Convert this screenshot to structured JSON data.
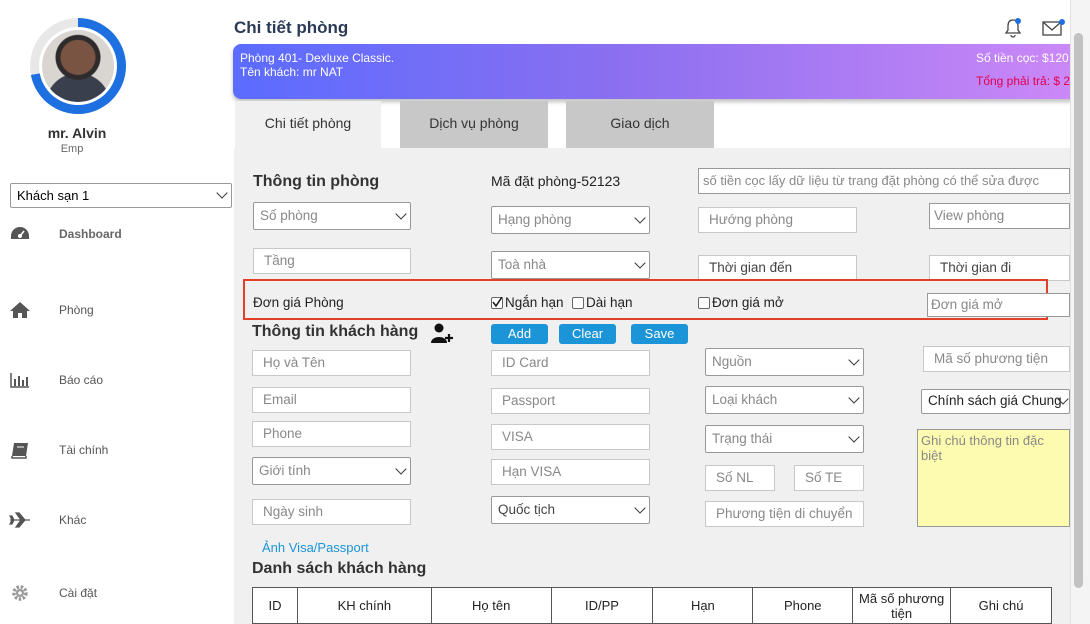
{
  "user": {
    "name": "mr. Alvin",
    "role": "Emp"
  },
  "hotel_select": "Khách sạn 1",
  "nav": [
    {
      "label": "Dashboard",
      "icon": "dashboard-icon"
    },
    {
      "label": "Phòng",
      "icon": "home-icon"
    },
    {
      "label": "Báo cáo",
      "icon": "bar-chart-icon"
    },
    {
      "label": "Tài chính",
      "icon": "book-icon"
    },
    {
      "label": "Khác",
      "icon": "plane-icon"
    },
    {
      "label": "Cài đặt",
      "icon": "gear-icon"
    }
  ],
  "header": {
    "title": "Chi tiết phòng"
  },
  "banner": {
    "room": "Phòng 401- Dexluxe Classic.",
    "guest": "Tên khách: mr NAT",
    "deposit": "Số tiền cọc: $120",
    "total": "Tổng phải trả: $ 2"
  },
  "tabs": [
    "Chi tiết phòng",
    "Dịch vụ phòng",
    "Giao dịch"
  ],
  "room_info": {
    "title": "Thông tin phòng",
    "booking_code": "Mã đặt phòng-52123",
    "deposit_placeholder": "số tiền cọc lấy dữ liệu từ trang đặt phòng có thể sửa được",
    "room_no": "Số phòng",
    "room_class": "Hạng phòng",
    "direction": "Hướng phòng",
    "view": "View phòng",
    "floor": "Tầng",
    "building": "Toà nhà",
    "arrival": "Thời gian đến",
    "departure": "Thời gian đi"
  },
  "price_row": {
    "label": "Đơn giá Phòng",
    "short_term": "Ngắn hạn",
    "short_term_checked": true,
    "long_term": "Dài hạn",
    "open_price": "Đơn giá mở",
    "open_price_placeholder": "Đơn giá mở"
  },
  "guest_info": {
    "title": "Thông tin khách hàng",
    "add": "Add",
    "clear": "Clear",
    "save": "Save",
    "full_name": "Họ và Tên",
    "id_card": "ID Card",
    "source": "Nguồn",
    "commute_code": "Mã số phương tiện",
    "email": "Email",
    "passport": "Passport",
    "guest_type": "Loại khách",
    "price_policy": "Chính sách giá Chung",
    "phone": "Phone",
    "visa": "VISA",
    "status": "Trạng thái",
    "note_placeholder": "Ghi chú thông tin đặc biệt",
    "gender": "Giới tính",
    "visa_expiry": "Hạn VISA",
    "adults": "Số NL",
    "children": "Số TE",
    "birthday": "Ngày sinh",
    "nationality": "Quốc tịch",
    "transport": "Phương tiện di chuyển",
    "visa_photo_link": "Ảnh Visa/Passport"
  },
  "guest_list": {
    "title": "Danh sách khách hàng",
    "columns": [
      "ID",
      "KH chính",
      "Họ tên",
      "ID/PP",
      "Hạn",
      "Phone",
      "Mã số phương tiện",
      "Ghi chú"
    ]
  },
  "colors": {
    "accent": "#1c94d8",
    "title": "#2a3a55",
    "highlight": "#e0402a",
    "total": "#e0004d"
  }
}
